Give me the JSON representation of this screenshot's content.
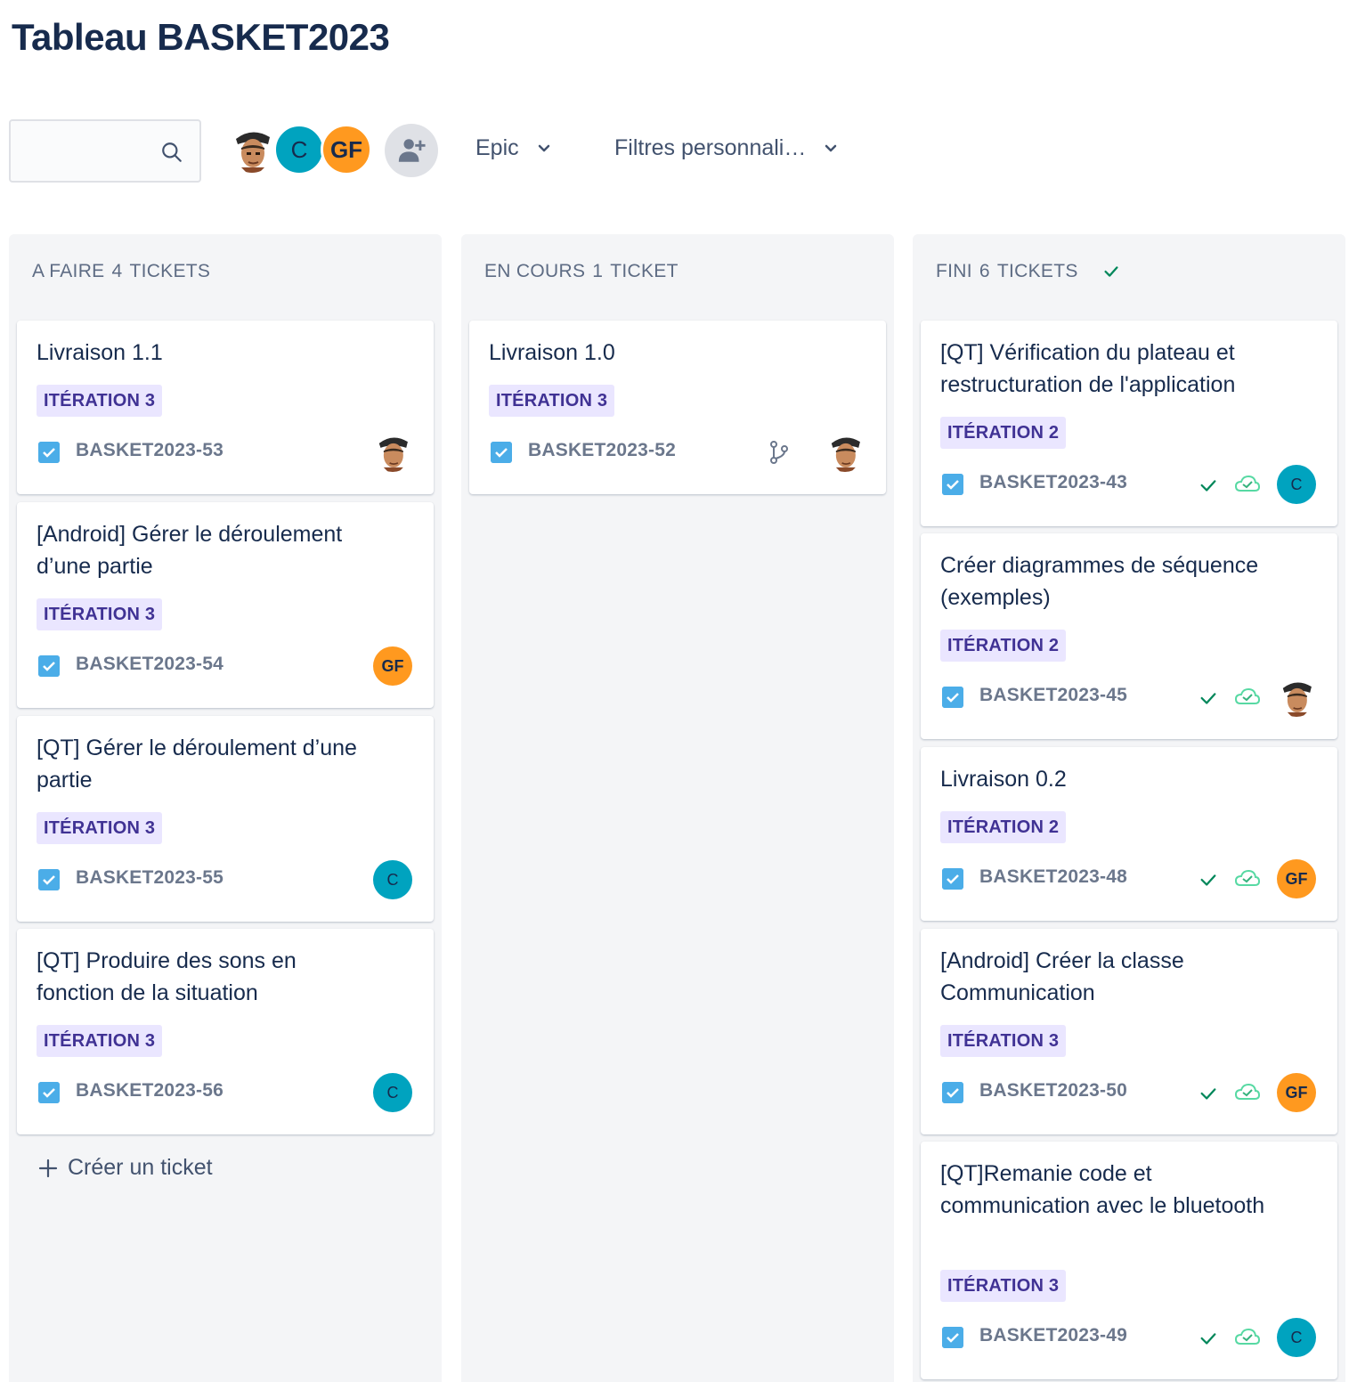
{
  "page": {
    "title": "Tableau BASKET2023"
  },
  "toolbar": {
    "search": {
      "value": "",
      "placeholder": ""
    },
    "avatars": [
      {
        "kind": "photo",
        "icon": "user-photo-avatar"
      },
      {
        "kind": "initials",
        "initials": "C",
        "color": "#00a3bf"
      },
      {
        "kind": "initials",
        "initials": "GF",
        "color": "#ff991f"
      }
    ],
    "add_people_icon": "add-user-icon",
    "filter_epic": "Epic",
    "filter_custom": "Filtres personnali…"
  },
  "columns": [
    {
      "name": "A FAIRE",
      "count": "4",
      "count_label": "TICKETS",
      "cards": [
        {
          "title": "Livraison 1.1",
          "tag": "ITÉRATION 3",
          "key": "BASKET2023-53",
          "assignee": "photo"
        },
        {
          "title": "[Android] Gérer le déroulement d’une partie",
          "tag": "ITÉRATION 3",
          "key": "BASKET2023-54",
          "assignee": "GF"
        },
        {
          "title": "[QT] Gérer le déroulement d’une partie",
          "tag": "ITÉRATION 3",
          "key": "BASKET2023-55",
          "assignee": "C"
        },
        {
          "title": "[QT] Produire des sons en fonction de la situation",
          "tag": "ITÉRATION 3",
          "key": "BASKET2023-56",
          "assignee": "C"
        }
      ],
      "create_label": "Créer un ticket"
    },
    {
      "name": "EN COURS",
      "count": "1",
      "count_label": "TICKET",
      "cards": [
        {
          "title": "Livraison 1.0",
          "tag": "ITÉRATION 3",
          "key": "BASKET2023-52",
          "assignee": "photo",
          "branch": true
        }
      ]
    },
    {
      "name": "FINI",
      "count": "6",
      "count_label": "TICKETS",
      "done": true,
      "cards": [
        {
          "title": "[QT] Vérification du plateau et restructuration de l'application",
          "tag": "ITÉRATION 2",
          "key": "BASKET2023-43",
          "assignee": "C"
        },
        {
          "title": "Créer diagrammes de séquence (exemples)",
          "tag": "ITÉRATION 2",
          "key": "BASKET2023-45",
          "assignee": "photo"
        },
        {
          "title": "Livraison 0.2",
          "tag": "ITÉRATION 2",
          "key": "BASKET2023-48",
          "assignee": "GF"
        },
        {
          "title": "[Android] Créer la classe Communication",
          "tag": "ITÉRATION 3",
          "key": "BASKET2023-50",
          "assignee": "GF"
        },
        {
          "title": "[QT]Remanie code et communication avec le bluetooth",
          "tag": "ITÉRATION 3",
          "key": "BASKET2023-49",
          "assignee": "C"
        }
      ]
    }
  ],
  "colors": {
    "tag_bg": "#eae6ff",
    "tag_text": "#403294",
    "check_blue": "#4bade8",
    "done_green": "#00875a",
    "column_bg": "#f4f5f7"
  }
}
